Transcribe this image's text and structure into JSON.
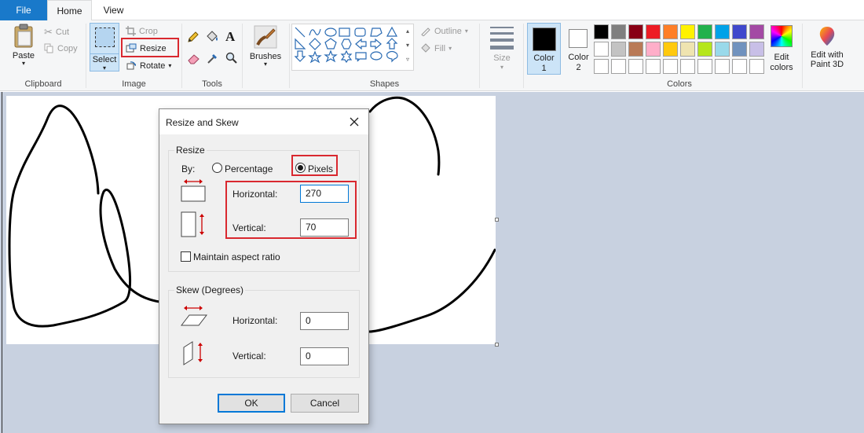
{
  "tabs": {
    "file": "File",
    "home": "Home",
    "view": "View"
  },
  "clipboard": {
    "paste": "Paste",
    "cut": "Cut",
    "copy": "Copy",
    "label": "Clipboard"
  },
  "image": {
    "select": "Select",
    "crop": "Crop",
    "resize": "Resize",
    "rotate": "Rotate",
    "label": "Image"
  },
  "tools": {
    "label": "Tools"
  },
  "brushes": {
    "label": "Brushes"
  },
  "shapes": {
    "outline": "Outline",
    "fill": "Fill",
    "label": "Shapes"
  },
  "size": {
    "label": "Size"
  },
  "colors": {
    "color1_line1": "Color",
    "color1_line2": "1",
    "color2_line1": "Color",
    "color2_line2": "2",
    "edit_line1": "Edit",
    "edit_line2": "colors",
    "paint3d_line1": "Edit with",
    "paint3d_line2": "Paint 3D",
    "label": "Colors",
    "color1_value": "#000000",
    "color2_value": "#ffffff",
    "palette_row1": [
      "#000000",
      "#7f7f7f",
      "#880015",
      "#ed1c24",
      "#ff7f27",
      "#fff200",
      "#22b14c",
      "#00a2e8",
      "#3f48cc",
      "#a349a4"
    ],
    "palette_row2": [
      "#ffffff",
      "#c3c3c3",
      "#b97a57",
      "#ffaec9",
      "#ffc90e",
      "#efe4b0",
      "#b5e61d",
      "#99d9ea",
      "#7092be",
      "#c8bfe7"
    ],
    "palette_row3": [
      "#ffffff",
      "#ffffff",
      "#ffffff",
      "#ffffff",
      "#ffffff",
      "#ffffff",
      "#ffffff",
      "#ffffff",
      "#ffffff",
      "#ffffff"
    ]
  },
  "dialog": {
    "title": "Resize and Skew",
    "resize_legend": "Resize",
    "by_label": "By:",
    "percentage_label": "Percentage",
    "pixels_label": "Pixels",
    "horizontal_label": "Horizontal:",
    "horizontal_value": "270",
    "vertical_label": "Vertical:",
    "vertical_value": "70",
    "aspect_label": "Maintain aspect ratio",
    "skew_legend": "Skew (Degrees)",
    "skew_horizontal_label": "Horizontal:",
    "skew_horizontal_value": "0",
    "skew_vertical_label": "Vertical:",
    "skew_vertical_value": "0",
    "ok_label": "OK",
    "cancel_label": "Cancel"
  },
  "accent": "#1979ca",
  "highlight": "#d9282f"
}
